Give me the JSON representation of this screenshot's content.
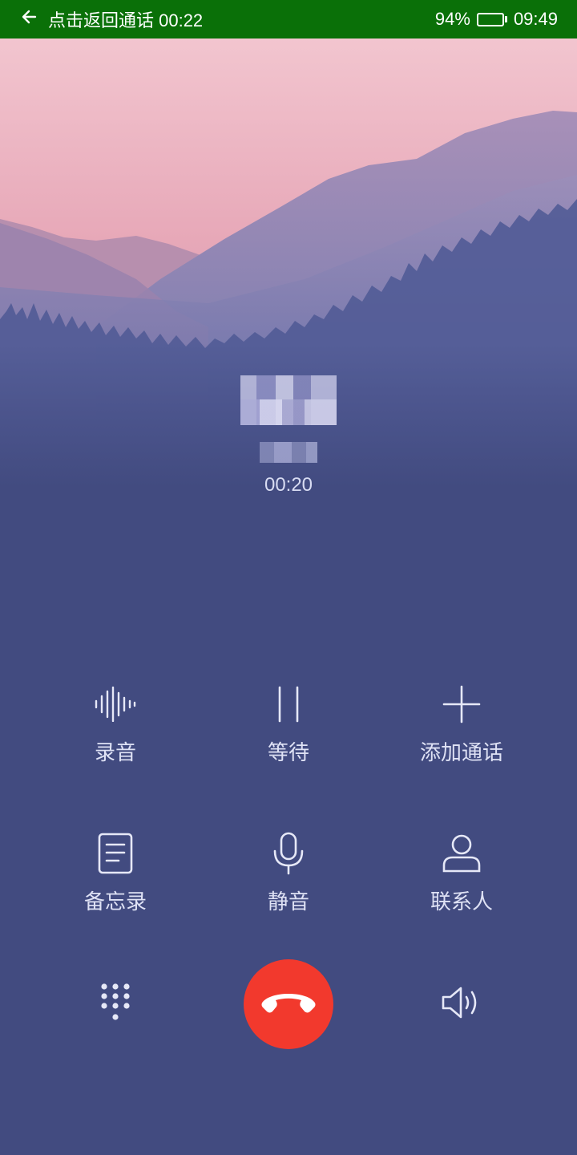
{
  "status_bar": {
    "back_text": "点击返回通话 00:22",
    "battery": "94%",
    "battery_level": 0.94,
    "time": "09:49"
  },
  "call": {
    "timer": "00:20"
  },
  "actions": {
    "record": {
      "label": "录音",
      "icon": "waveform-icon"
    },
    "hold": {
      "label": "等待",
      "icon": "pause-icon"
    },
    "add_call": {
      "label": "添加通话",
      "icon": "plus-icon"
    },
    "notes": {
      "label": "备忘录",
      "icon": "note-icon"
    },
    "mute": {
      "label": "静音",
      "icon": "microphone-icon"
    },
    "contacts": {
      "label": "联系人",
      "icon": "person-icon"
    }
  },
  "bottom": {
    "keypad_icon": "dialpad-icon",
    "hangup_icon": "phone-hangup-icon",
    "speaker_icon": "speaker-icon",
    "hangup_color": "#f2392d"
  },
  "colors": {
    "status_bar": "#0a7008",
    "background": "#424b80"
  }
}
